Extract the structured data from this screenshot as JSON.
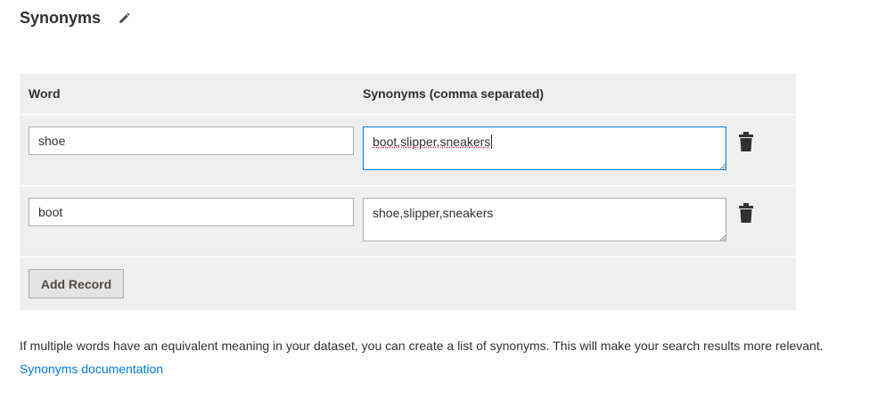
{
  "section": {
    "title": "Synonyms",
    "edit_icon": "pencil-icon"
  },
  "table": {
    "columns": {
      "word": "Word",
      "synonyms": "Synonyms (comma separated)"
    },
    "rows": [
      {
        "word": "shoe",
        "synonyms": "boot,slipper,sneakers",
        "focused": true,
        "delete_icon": "trash-icon"
      },
      {
        "word": "boot",
        "synonyms": "shoe,slipper,sneakers",
        "focused": false,
        "delete_icon": "trash-icon"
      }
    ],
    "add_label": "Add Record"
  },
  "help": {
    "text": "If multiple words have an equivalent meaning in your dataset, you can create a list of synonyms. This will make your search results more relevant.",
    "link_label": "Synonyms documentation"
  },
  "colors": {
    "panel_bg": "#efefef",
    "link": "#007bdb",
    "focus_border": "#007bdb"
  }
}
